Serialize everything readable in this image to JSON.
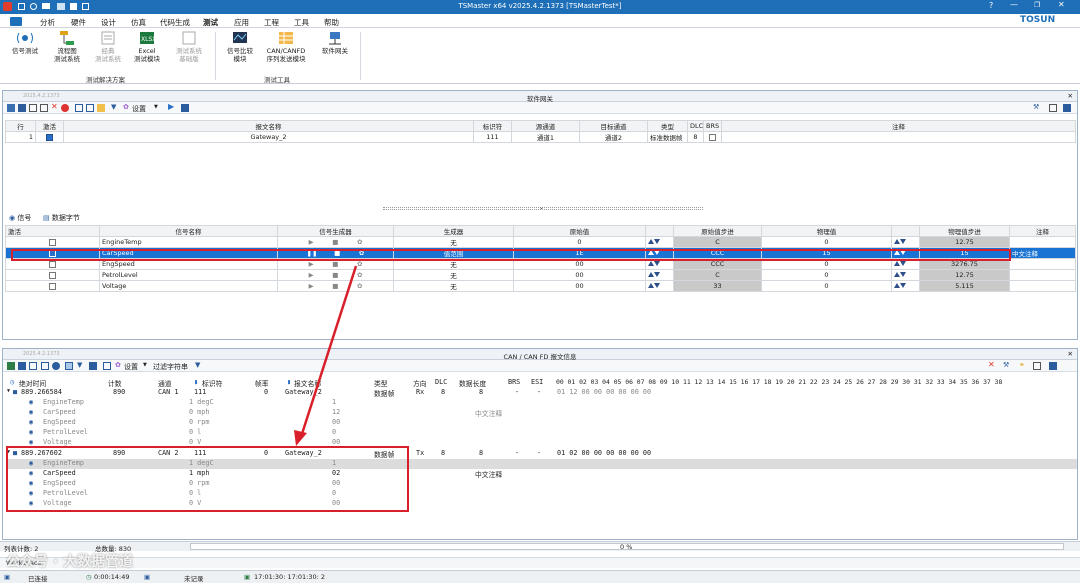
{
  "window": {
    "title": "TSMaster x64 v2025.4.2.1373 [TSMasterTest*]",
    "brand": "TOSUN",
    "accent": "#1e6fb8"
  },
  "menu": [
    "分析",
    "硬件",
    "设计",
    "仿真",
    "代码生成",
    "测试",
    "应用",
    "工程",
    "工具",
    "帮助"
  ],
  "menu_active": "测试",
  "ribbon": {
    "buttons": [
      {
        "label1": "信号测试",
        "label2": "",
        "icon": "signal-test-icon"
      },
      {
        "label1": "流程图",
        "label2": "测试系统",
        "icon": "flowchart-icon"
      },
      {
        "label1": "经典",
        "label2": "测试系统",
        "icon": "classic-test-icon"
      },
      {
        "label1": "Excel",
        "label2": "测试模块",
        "icon": "excel-icon"
      },
      {
        "label1": "测试系统",
        "label2": "基础版",
        "icon": "test-basic-icon"
      },
      {
        "label1": "信号比较",
        "label2": "模块",
        "icon": "signal-compare-icon"
      },
      {
        "label1": "CAN/CANFD",
        "label2": "序列发送模块",
        "icon": "sequence-icon"
      },
      {
        "label1": "软件网关",
        "label2": "",
        "icon": "gateway-icon"
      }
    ],
    "groups": [
      "测试解决方案",
      "测试工具"
    ]
  },
  "gateway_panel": {
    "title": "软件网关",
    "version": "2025.4.2.1373",
    "settings": "设置",
    "columns": [
      "行",
      "激活",
      "报文名称",
      "标识符",
      "源通道",
      "目标通道",
      "类型",
      "DLC",
      "BRS",
      "注释"
    ],
    "rows": [
      {
        "row": "1",
        "active": true,
        "name": "Gateway_2",
        "id": "111",
        "src": "通道1",
        "dst": "通道2",
        "type": "标准数据帧",
        "dlc": "8",
        "brs": false,
        "note": ""
      }
    ]
  },
  "signal_tabs": {
    "signal": "信号",
    "data_bytes": "数据字节"
  },
  "signal_table": {
    "columns": [
      "激活",
      "信号名称",
      "信号生成器",
      "生成器",
      "原始值",
      "原始值步进",
      "物理值",
      "物理值步进",
      "注释"
    ],
    "rows": [
      {
        "active": false,
        "name": "EngineTemp",
        "gen": "无",
        "raw": "0",
        "raw_step": "C",
        "phys": "0",
        "phys_step": "12.75",
        "note": ""
      },
      {
        "active": true,
        "name": "CarSpeed",
        "gen": "值范围",
        "raw": "1E",
        "raw_step": "CCC",
        "phys": "15",
        "phys_step": "15",
        "note": "中文注释"
      },
      {
        "active": false,
        "name": "EngSpeed",
        "gen": "无",
        "raw": "00",
        "raw_step": "CCC",
        "phys": "0",
        "phys_step": "3276.75",
        "note": ""
      },
      {
        "active": false,
        "name": "PetrolLevel",
        "gen": "无",
        "raw": "00",
        "raw_step": "C",
        "phys": "0",
        "phys_step": "12.75",
        "note": ""
      },
      {
        "active": false,
        "name": "Voltage",
        "gen": "无",
        "raw": "00",
        "raw_step": "33",
        "phys": "0",
        "phys_step": "5.115",
        "note": ""
      }
    ]
  },
  "can_panel": {
    "title": "CAN / CAN FD 报文信息",
    "version": "2025.4.2.1373",
    "settings": "设置",
    "filter": "过滤字符串",
    "columns": [
      "绝对时间",
      "计数",
      "通道",
      "标识符",
      "帧率",
      "报文名称",
      "类型",
      "方向",
      "DLC",
      "数据长度",
      "BRS",
      "ESI"
    ],
    "byte_header": "00 01 02 03 04 05 06 07 08 09 10 11 12 13 14 15 16 17 18 19 20 21 22 23 24 25 26 27 28 29 30 31 32 33 34 35 36 37 38",
    "frames": [
      {
        "time": "889.266584",
        "count": "890",
        "chan": "CAN 1",
        "id": "111",
        "rate": "0",
        "name": "Gateway_2",
        "type": "数据帧",
        "dir": "Rx",
        "dlc": "8",
        "len": "8",
        "brs": "-",
        "esi": "-",
        "bytes": "01 12 00 00 00 00 00 00",
        "signals": [
          {
            "name": "EngineTemp",
            "val": "1 degC",
            "raw": "1"
          },
          {
            "name": "CarSpeed",
            "val": "0 mph",
            "raw": "12",
            "note": "中文注释"
          },
          {
            "name": "EngSpeed",
            "val": "0 rpm",
            "raw": "00"
          },
          {
            "name": "PetrolLevel",
            "val": "0 l",
            "raw": "0"
          },
          {
            "name": "Voltage",
            "val": "0 V",
            "raw": "00"
          }
        ]
      },
      {
        "time": "889.267602",
        "count": "890",
        "chan": "CAN 2",
        "id": "111",
        "rate": "0",
        "name": "Gateway_2",
        "type": "数据帧",
        "dir": "Tx",
        "dlc": "8",
        "len": "8",
        "brs": "-",
        "esi": "-",
        "bytes": "01 02 00 00 00 00 00 00",
        "signals": [
          {
            "name": "EngineTemp",
            "val": "1 degC",
            "raw": "1"
          },
          {
            "name": "CarSpeed",
            "val": "1 mph",
            "raw": "02",
            "note": "中文注释"
          },
          {
            "name": "EngSpeed",
            "val": "0 rpm",
            "raw": "00"
          },
          {
            "name": "PetrolLevel",
            "val": "0 l",
            "raw": "0"
          },
          {
            "name": "Voltage",
            "val": "0 V",
            "raw": "00"
          }
        ]
      }
    ]
  },
  "status": {
    "list_count": "列表计数: 2",
    "total": "总数量: 830",
    "progress": "0 %",
    "progress_value": 0,
    "workspace": "Workspace",
    "connected": "已连接",
    "time": "0:00:14:49",
    "record": "未记录",
    "timestamp": "17:01:30: 17:01:30: 2"
  },
  "watermark": "公众号 · 大数据管道"
}
